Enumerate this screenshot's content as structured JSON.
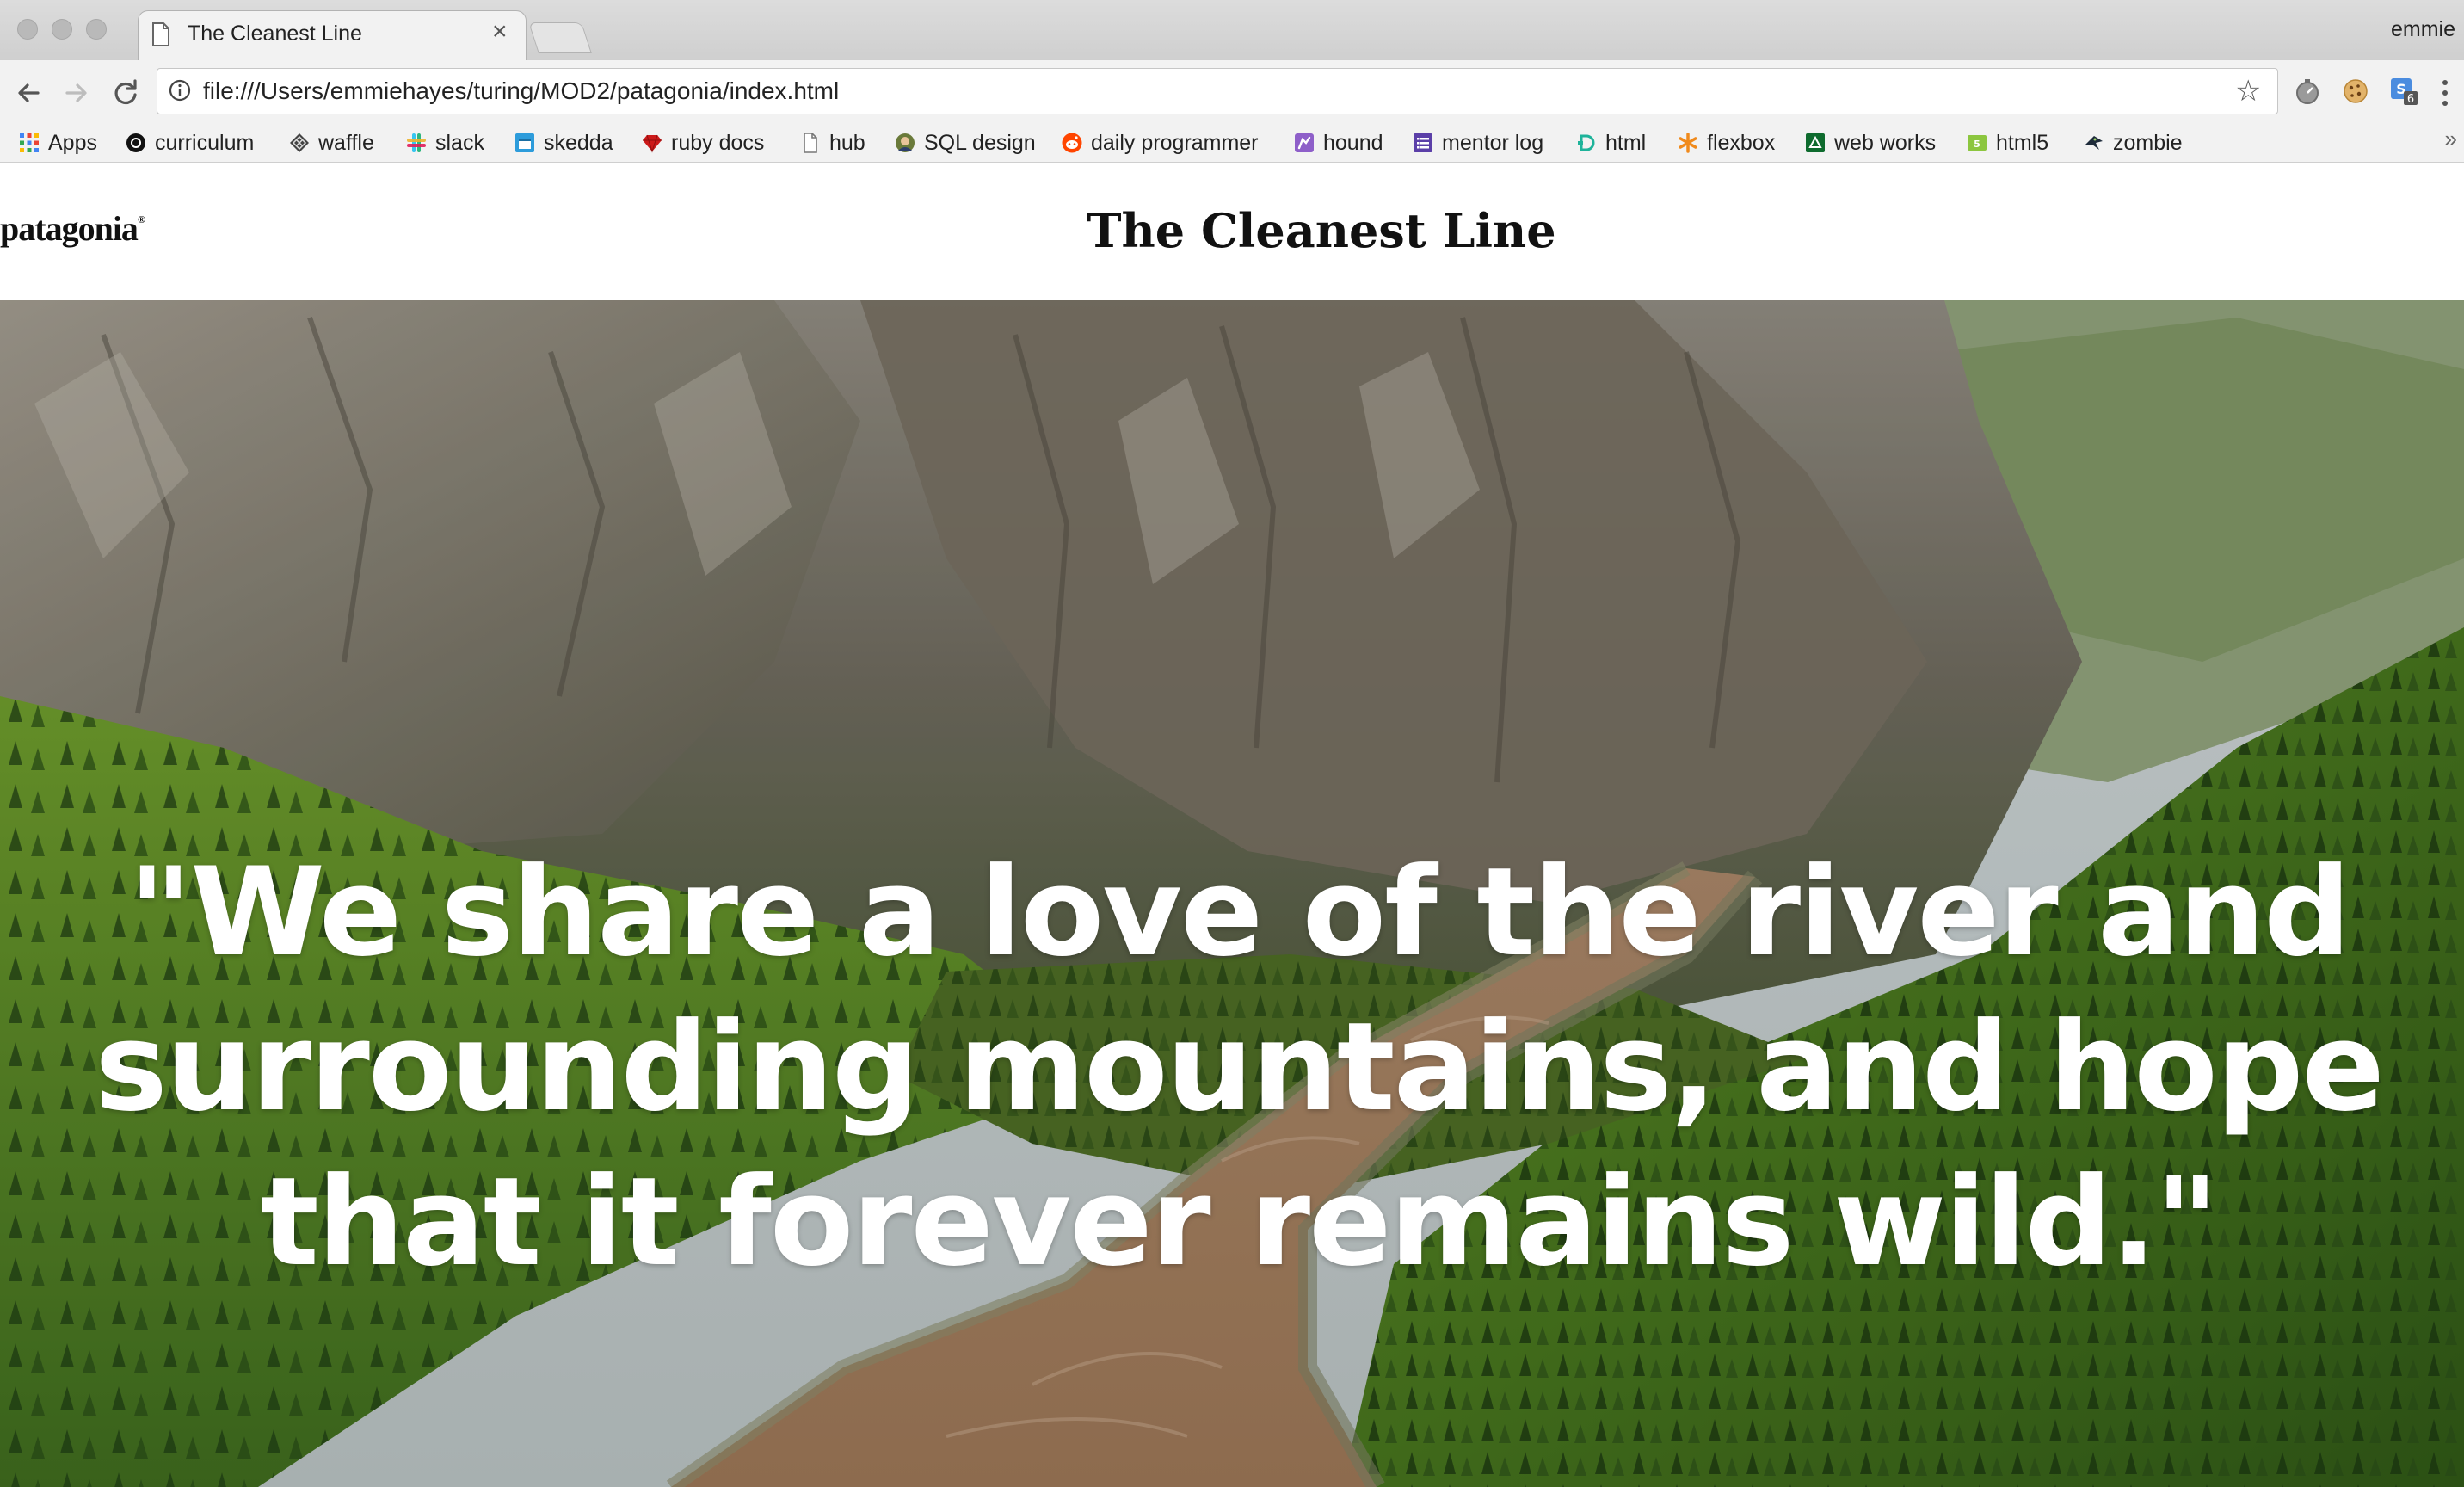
{
  "browser": {
    "tab": {
      "title": "The Cleanest Line",
      "close_icon": "close-icon"
    },
    "profile_name": "emmie",
    "address_bar": {
      "url": "file:///Users/emmiehayes/turing/MOD2/patagonia/index.html"
    },
    "extension_badge": "6",
    "bookmarks": [
      {
        "label": "Apps",
        "icon": "apps-grid-icon"
      },
      {
        "label": "curriculum",
        "icon": "turing-icon"
      },
      {
        "label": "waffle",
        "icon": "waffle-icon"
      },
      {
        "label": "slack",
        "icon": "slack-icon"
      },
      {
        "label": "skedda",
        "icon": "skedda-icon"
      },
      {
        "label": "ruby docs",
        "icon": "ruby-icon"
      },
      {
        "label": "hub",
        "icon": "page-icon"
      },
      {
        "label": "SQL design",
        "icon": "sql-avatar-icon"
      },
      {
        "label": "daily programmer",
        "icon": "reddit-icon"
      },
      {
        "label": "hound",
        "icon": "hound-icon"
      },
      {
        "label": "mentor log",
        "icon": "list-icon"
      },
      {
        "label": "html",
        "icon": "html-d-icon"
      },
      {
        "label": "flexbox",
        "icon": "asterisk-icon"
      },
      {
        "label": "web works",
        "icon": "webworks-icon"
      },
      {
        "label": "html5",
        "icon": "html5-icon"
      },
      {
        "label": "zombie",
        "icon": "zombie-icon"
      }
    ],
    "more_bookmarks": "»"
  },
  "page": {
    "logo": "patagonia",
    "title": "The Cleanest Line",
    "hero_quote": "\"We share a love of the river and surrounding mountains, and hope that it forever remains wild.\""
  }
}
